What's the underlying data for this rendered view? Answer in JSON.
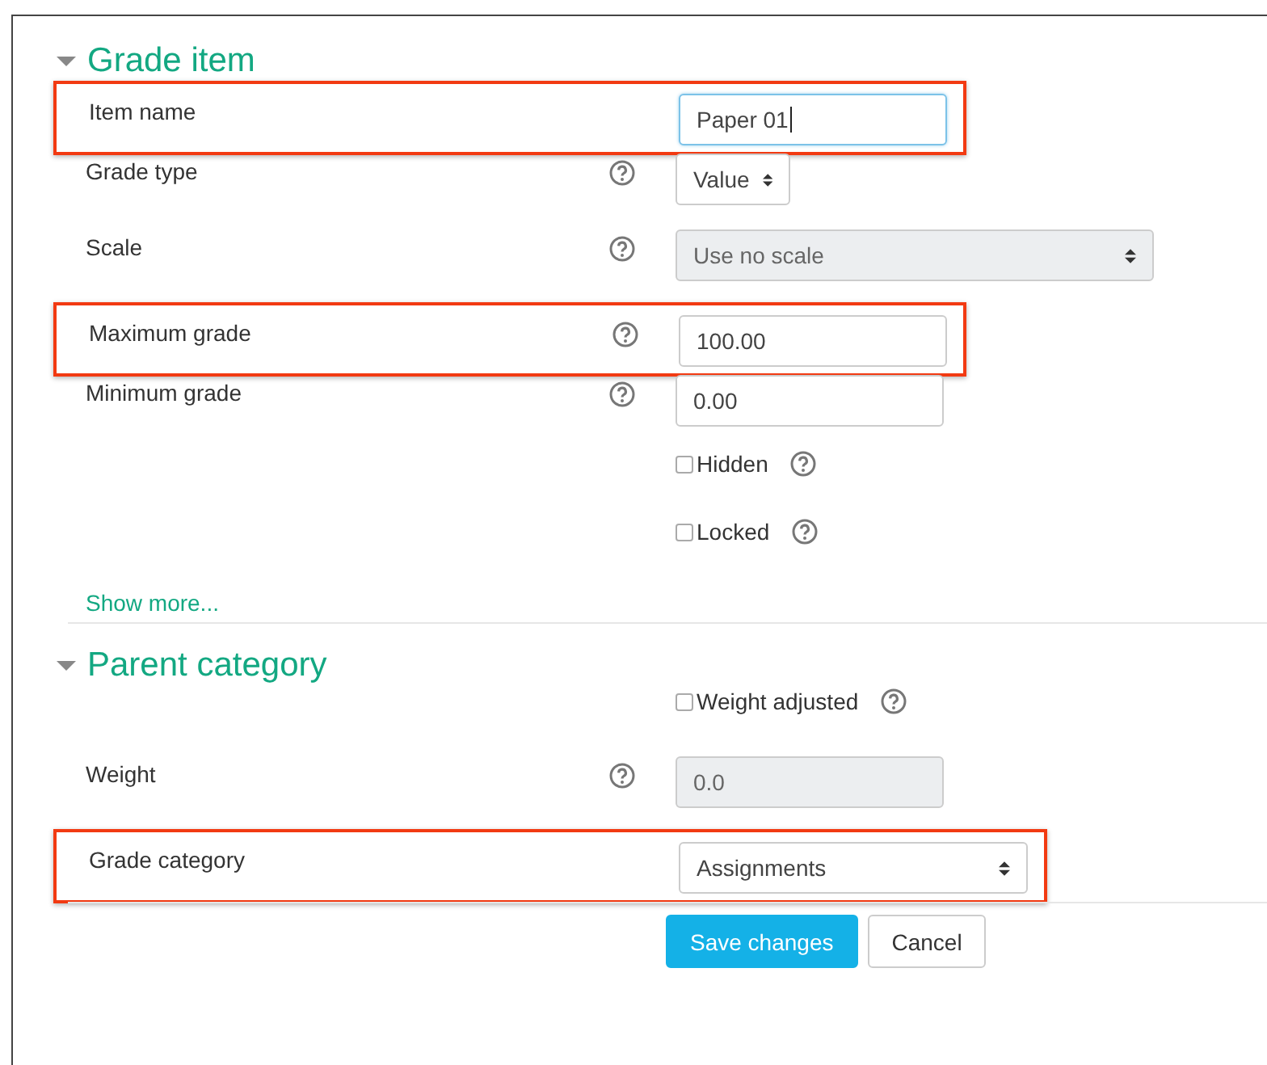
{
  "sections": [
    {
      "title": "Grade item",
      "expanded": true,
      "rows": [
        {
          "kind": "text",
          "label": "Item name",
          "help": false,
          "value": "Paper 01",
          "focused": true,
          "disabled": false,
          "highlighted": true
        },
        {
          "kind": "compact-select",
          "label": "Grade type",
          "help": true,
          "value": "Value",
          "disabled": false,
          "highlighted": false
        },
        {
          "kind": "long-select",
          "label": "Scale",
          "help": true,
          "value": "Use no scale",
          "disabled": true,
          "highlighted": false
        },
        {
          "kind": "text",
          "label": "Maximum grade",
          "help": true,
          "value": "100.00",
          "focused": false,
          "disabled": false,
          "highlighted": true
        },
        {
          "kind": "text",
          "label": "Minimum grade",
          "help": true,
          "value": "0.00",
          "focused": false,
          "disabled": false,
          "highlighted": false
        },
        {
          "kind": "checkbox",
          "text": "Hidden",
          "help": true,
          "checked": false
        },
        {
          "kind": "checkbox",
          "text": "Locked",
          "help": true,
          "checked": false
        }
      ],
      "show_more": "Show more..."
    },
    {
      "title": "Parent category",
      "expanded": true,
      "rows": [
        {
          "kind": "checkbox",
          "text": "Weight adjusted",
          "help": true,
          "checked": false
        },
        {
          "kind": "text",
          "label": "Weight",
          "help": true,
          "value": "0.0",
          "focused": false,
          "disabled": true,
          "highlighted": false
        },
        {
          "kind": "select",
          "label": "Grade category",
          "help": false,
          "value": "Assignments",
          "disabled": false,
          "highlighted": true
        }
      ]
    }
  ],
  "buttons": [
    {
      "label": "Save changes",
      "primary": true
    },
    {
      "label": "Cancel",
      "primary": false
    }
  ]
}
